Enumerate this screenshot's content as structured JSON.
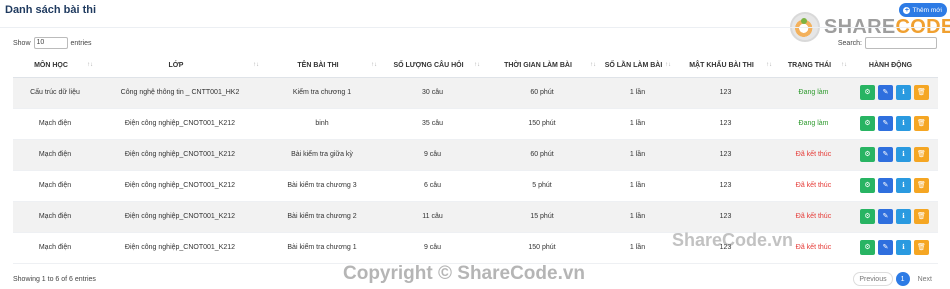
{
  "header": {
    "title": "Danh sách bài thi",
    "add_button": "Thêm mới"
  },
  "logo": {
    "text_part1": "SHARE",
    "text_part2": "CODE.vn"
  },
  "controls": {
    "show_label": "Show",
    "page_length": "10",
    "entries_label": "entries",
    "search_label": "Search:"
  },
  "table": {
    "columns": [
      "MÔN HỌC",
      "LỚP",
      "TÊN BÀI THI",
      "SỐ LƯỢNG CÂU HỎI",
      "THỜI GIAN LÀM BÀI",
      "SỐ LẦN LÀM BÀI",
      "MẬT KHẨU BÀI THI",
      "TRẠNG THÁI",
      "HÀNH ĐỘNG"
    ],
    "rows": [
      {
        "subject": "Cấu trúc dữ liệu",
        "class": "Công nghệ thông tin _ CNTT001_HK2",
        "exam": "Kiểm tra chương 1",
        "questions": "30 câu",
        "duration": "60 phút",
        "attempts": "1 lần",
        "password": "123",
        "status": "Đang làm"
      },
      {
        "subject": "Mạch điện",
        "class": "Điện công nghiệp_CNOT001_K212",
        "exam": "binh",
        "questions": "35 câu",
        "duration": "150 phút",
        "attempts": "1 lần",
        "password": "123",
        "status": "Đang làm"
      },
      {
        "subject": "Mạch điện",
        "class": "Điện công nghiệp_CNOT001_K212",
        "exam": "Bài kiểm tra giữa kỳ",
        "questions": "9 câu",
        "duration": "60 phút",
        "attempts": "1 lần",
        "password": "123",
        "status": "Đã kết thúc"
      },
      {
        "subject": "Mạch điện",
        "class": "Điện công nghiệp_CNOT001_K212",
        "exam": "Bài kiểm tra chương 3",
        "questions": "6 câu",
        "duration": "5 phút",
        "attempts": "1 lần",
        "password": "123",
        "status": "Đã kết thúc"
      },
      {
        "subject": "Mạch điện",
        "class": "Điện công nghiệp_CNOT001_K212",
        "exam": "Bài kiểm tra chương 2",
        "questions": "11 câu",
        "duration": "15 phút",
        "attempts": "1 lần",
        "password": "123",
        "status": "Đã kết thúc"
      },
      {
        "subject": "Mạch điện",
        "class": "Điện công nghiệp_CNOT001_K212",
        "exam": "Bài kiểm tra chương 1",
        "questions": "9 câu",
        "duration": "150 phút",
        "attempts": "1 lần",
        "password": "123",
        "status": "Đã kết thúc"
      }
    ],
    "status_colors": {
      "Đang làm": "#2e9a2e",
      "Đã kết thúc": "#e53935"
    },
    "action_icons": [
      "gear-icon",
      "edit-icon",
      "info-icon",
      "trash-icon"
    ]
  },
  "footer": {
    "info": "Showing 1 to 6 of 6 entries",
    "previous": "Previous",
    "current_page": "1",
    "next": "Next"
  },
  "watermarks": {
    "center": "ShareCode.vn",
    "bottom": "Copyright © ShareCode.vn"
  }
}
